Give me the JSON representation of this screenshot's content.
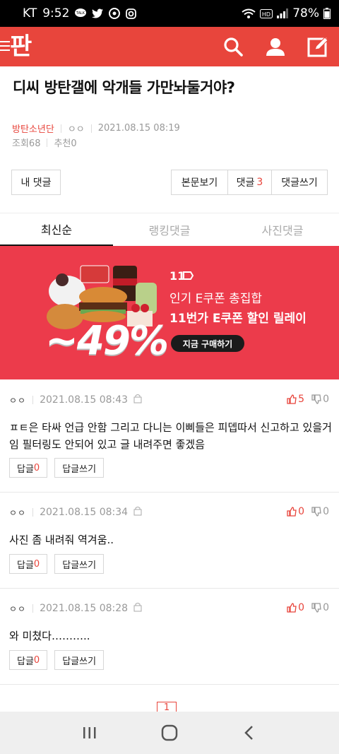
{
  "status": {
    "carrier": "KT",
    "time": "9:52",
    "battery": "78%",
    "icons": [
      "talk-icon",
      "twitter-icon",
      "weverse-icon",
      "instagram-icon",
      "wifi-icon",
      "hd-icon",
      "signal-icon",
      "battery-icon"
    ]
  },
  "header": {
    "logo": "판",
    "icons": [
      "menu-icon",
      "search-icon",
      "user-icon",
      "write-icon"
    ],
    "accent": "#e8453c"
  },
  "post": {
    "title": "디씨 방탄갤에 악개들 가만놔둘거야?",
    "category": "방탄소년단",
    "author": "ㅇㅇ",
    "datetime": "2021.08.15 08:19",
    "views": "조회68",
    "recommends": "추천0"
  },
  "actions": {
    "my_comments": "내 댓글",
    "view_post": "본문보기",
    "comments_label": "댓글",
    "comments_count": "3",
    "write_comment": "댓글쓰기"
  },
  "tabs": [
    "최신순",
    "랭킹댓글",
    "사진댓글"
  ],
  "banner": {
    "brand": "11",
    "line1": "인기 E쿠폰 총집합",
    "line2": "11번가 E쿠폰 할인 릴레이",
    "cta": "지금 구매하기",
    "discount": "~49%",
    "bg": "#ec3b4b"
  },
  "comments": [
    {
      "nick": "ㅇㅇ",
      "datetime": "2021.08.15 08:43",
      "up": "5",
      "down": "0",
      "text": "ㅍㅌ은 타싸 언급 안함 그리고 다니는 이삐들은 피뎁따서 신고하고 있을거임 필터링도 안되어 있고 글 내려주면 좋겠음",
      "reply_label": "답글",
      "reply_count": "0",
      "write_reply": "답글쓰기"
    },
    {
      "nick": "ㅇㅇ",
      "datetime": "2021.08.15 08:34",
      "up": "0",
      "down": "0",
      "text": "사진 좀 내려줘 역겨움..",
      "reply_label": "답글",
      "reply_count": "0",
      "write_reply": "답글쓰기"
    },
    {
      "nick": "ㅇㅇ",
      "datetime": "2021.08.15 08:28",
      "up": "0",
      "down": "0",
      "text": "와 미쳤다………..",
      "reply_label": "답글",
      "reply_count": "0",
      "write_reply": "답글쓰기"
    }
  ],
  "pagination": {
    "current": "1"
  },
  "navbar": {
    "icons": [
      "recent-apps-icon",
      "home-icon",
      "back-icon"
    ]
  }
}
